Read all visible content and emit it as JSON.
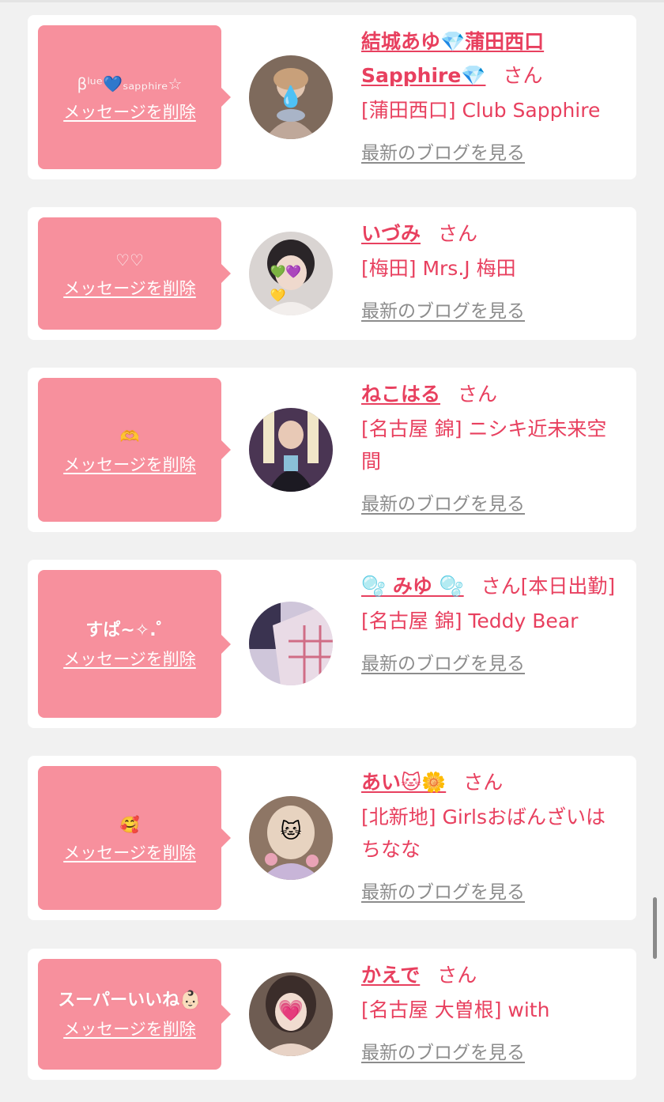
{
  "cards": [
    {
      "bubble_text": "βˡᵘᵉ💙ₛₐₚₚₕᵢᵣₑ☆",
      "delete_label": "メッセージを削除",
      "name": "結城あゆ💎蒲田西口Sapphire💎",
      "san": "さん",
      "shop": "[蒲田西口] Club Sapphire",
      "blog_label": "最新のブログを見る",
      "avatar_face": "💧",
      "avatar_bg": "#7e6a5c"
    },
    {
      "bubble_text": "♡♡",
      "delete_label": "メッセージを削除",
      "name": "いづみ",
      "san": "さん",
      "shop": "[梅田] Mrs.J 梅田",
      "blog_label": "最新のブログを見る",
      "avatar_face": "💚💜💛",
      "avatar_bg": "#d9d4d2"
    },
    {
      "bubble_text": "🫶",
      "delete_label": "メッセージを削除",
      "name": "ねこはる",
      "san": "さん",
      "shop": "[名古屋 錦] ニシキ近未来空間",
      "blog_label": "最新のブログを見る",
      "avatar_face": "",
      "avatar_bg": "#4a3553"
    },
    {
      "bubble_text": "すぱ~✧.゜",
      "delete_label": "メッセージを削除",
      "name": "🫧 みゆ 🫧",
      "san": "さん[本日出勤]",
      "shop": "[名古屋 錦] Teddy Bear",
      "blog_label": "最新のブログを見る",
      "avatar_face": "",
      "avatar_bg": "#cfc6da"
    },
    {
      "bubble_text": "🥰",
      "delete_label": "メッセージを削除",
      "name": "あい🐱🌼",
      "san": "さん",
      "shop": "[北新地] Girlsおばんざいはちなな",
      "blog_label": "最新のブログを見る",
      "avatar_face": "🐱",
      "avatar_bg": "#8e7665"
    },
    {
      "bubble_text": "スーパーいいね👶🏻",
      "delete_label": "メッセージを削除",
      "name": "かえで",
      "san": "さん",
      "shop": "[名古屋 大曽根] with",
      "blog_label": "最新のブログを見る",
      "avatar_face": "💗",
      "avatar_bg": "#6e5c52"
    }
  ],
  "colors": {
    "accent": "#e8405f",
    "bubble": "#f7909d",
    "blog_link": "#8c8c8c",
    "background": "#f1f1f1"
  }
}
